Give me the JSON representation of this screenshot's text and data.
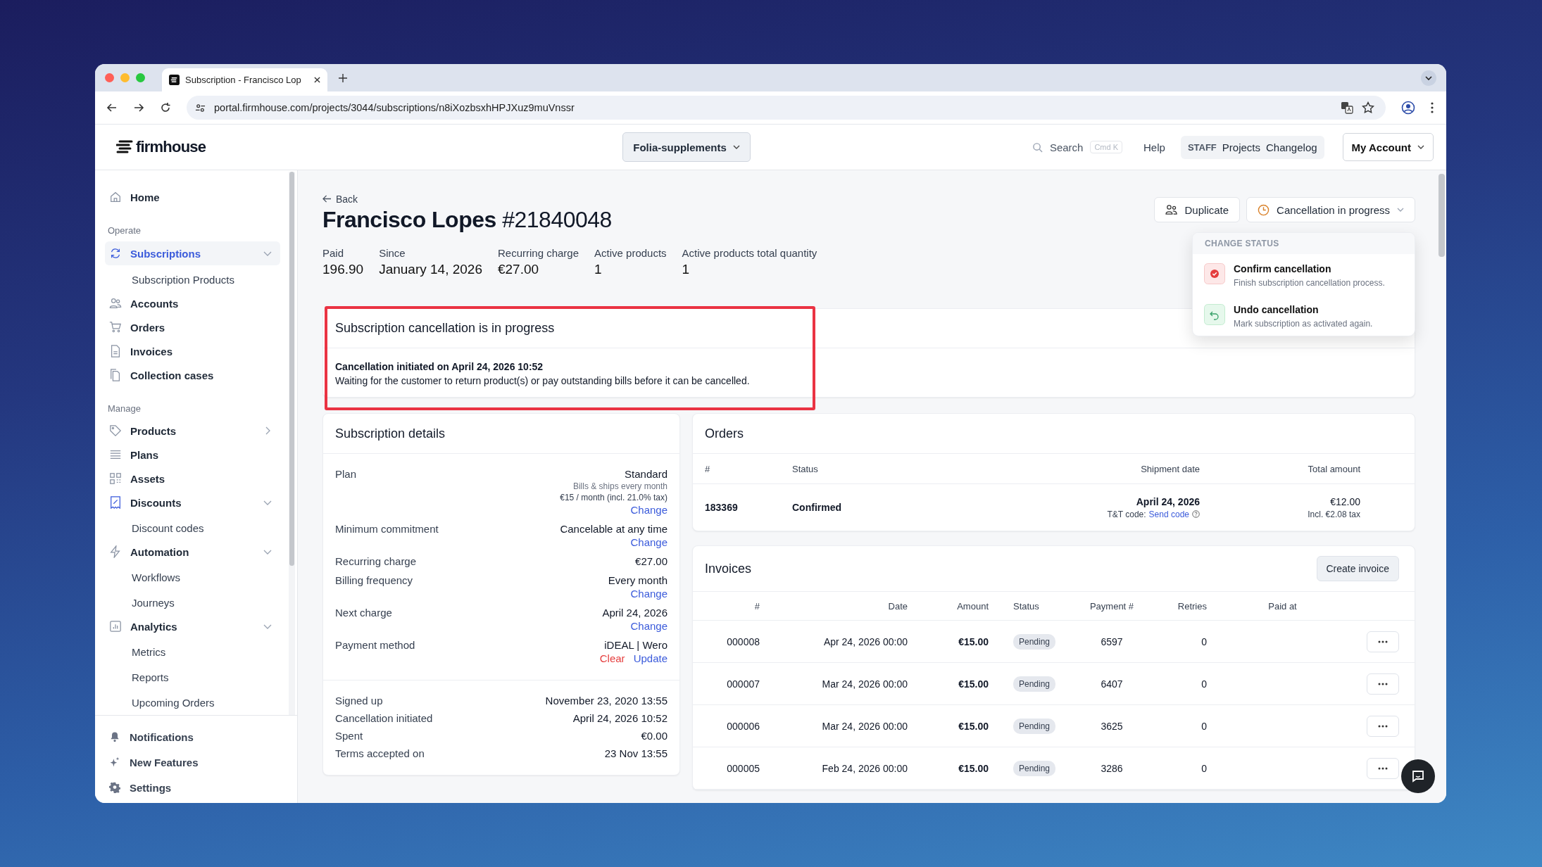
{
  "browser": {
    "tab_title": "Subscription - Francisco Lop",
    "url": "portal.firmhouse.com/projects/3044/subscriptions/n8iXozbsxhHPJXuz9muVnssr"
  },
  "header": {
    "logo": "firmhouse",
    "project": "Folia-supplements",
    "search": {
      "placeholder": "Search",
      "shortcut": "Cmd K"
    },
    "help": "Help",
    "staff_badge": "STAFF",
    "staff_links": [
      "Projects",
      "Changelog"
    ],
    "account": "My Account"
  },
  "sidebar": {
    "sections": [
      {
        "items": [
          {
            "label": "Home",
            "selected": false
          }
        ]
      },
      {
        "heading": "Operate",
        "items": [
          {
            "label": "Subscriptions",
            "selected": true,
            "expanded": true,
            "children": [
              {
                "label": "Subscription Products",
                "selected": false
              }
            ]
          },
          {
            "label": "Accounts",
            "selected": false
          },
          {
            "label": "Orders",
            "selected": false
          },
          {
            "label": "Invoices",
            "selected": false
          },
          {
            "label": "Collection cases",
            "selected": false
          }
        ]
      },
      {
        "heading": "Manage",
        "items": [
          {
            "label": "Products",
            "selected": false,
            "expanded": false
          },
          {
            "label": "Plans",
            "selected": false
          },
          {
            "label": "Assets",
            "selected": false
          },
          {
            "label": "Discounts",
            "selected": false,
            "expanded": true,
            "children": [
              {
                "label": "Discount codes",
                "selected": false
              }
            ]
          },
          {
            "label": "Automation",
            "selected": false,
            "expanded": true,
            "children": [
              {
                "label": "Workflows",
                "selected": false
              },
              {
                "label": "Journeys",
                "selected": false
              }
            ]
          },
          {
            "label": "Analytics",
            "selected": false,
            "expanded": true,
            "children": [
              {
                "label": "Metrics",
                "selected": false
              },
              {
                "label": "Reports",
                "selected": false
              },
              {
                "label": "Upcoming Orders",
                "selected": false
              }
            ]
          }
        ]
      }
    ],
    "footer": [
      "Notifications",
      "New Features",
      "Settings"
    ]
  },
  "page": {
    "back": "Back",
    "title": "**Francisco Lopes** #21840048",
    "stats": [
      {
        "label": "Paid",
        "value": "196.90"
      },
      {
        "label": "Since",
        "value": "January 14, 2026"
      },
      {
        "label": "Recurring charge",
        "value": "€27.00"
      },
      {
        "label": "Active products",
        "value": "1"
      },
      {
        "label": "Active products total quantity",
        "value": "1"
      }
    ],
    "duplicate": "Duplicate",
    "status": "Cancellation in progress",
    "status_menu": {
      "heading": "CHANGE STATUS",
      "options": [
        {
          "kind": "confirm",
          "title": "Confirm cancellation",
          "description": "Finish subscription cancellation process."
        },
        {
          "kind": "undo",
          "title": "Undo cancellation",
          "description": "Mark subscription as activated again."
        }
      ]
    }
  },
  "alert": {
    "title": "Subscription cancellation is in progress",
    "emphasis": "Cancellation initiated on April 24, 2026 10:52",
    "message": "Waiting for the customer to return product(s) or pay outstanding bills before it can be cancelled.",
    "highlighted": true
  },
  "details": {
    "title": "Subscription details",
    "groups": [
      [
        {
          "label": "Plan",
          "lines": [
            {
              "kind": "value",
              "text": "Standard"
            },
            {
              "kind": "note",
              "text": "Bills & ships every month"
            },
            {
              "kind": "price",
              "text": "€15 / month (incl. 21.0% tax)"
            }
          ],
          "actions": [
            {
              "kind": "link",
              "label": "Change"
            }
          ]
        },
        {
          "label": "Minimum commitment",
          "lines": [
            {
              "kind": "value",
              "text": "Cancelable at any time"
            }
          ],
          "actions": [
            {
              "kind": "link",
              "label": "Change"
            }
          ]
        },
        {
          "label": "Recurring charge",
          "lines": [
            {
              "kind": "value",
              "text": "€27.00"
            }
          ]
        },
        {
          "label": "Billing frequency",
          "lines": [
            {
              "kind": "value",
              "text": "Every month"
            }
          ],
          "actions": [
            {
              "kind": "link",
              "label": "Change"
            }
          ]
        },
        {
          "label": "Next charge",
          "lines": [
            {
              "kind": "value",
              "text": "April 24, 2026"
            }
          ],
          "actions": [
            {
              "kind": "link",
              "label": "Change"
            }
          ]
        },
        {
          "label": "Payment method",
          "lines": [
            {
              "kind": "value",
              "text": "iDEAL | Wero"
            }
          ],
          "actions": [
            {
              "kind": "danger",
              "label": "Clear"
            },
            {
              "kind": "link",
              "label": "Update"
            }
          ]
        }
      ],
      [
        {
          "label": "Signed up",
          "lines": [
            {
              "kind": "value",
              "text": "November 23, 2020 13:55"
            }
          ]
        },
        {
          "label": "Cancellation initiated",
          "lines": [
            {
              "kind": "value",
              "text": "April 24, 2026 10:52"
            }
          ]
        },
        {
          "label": "Spent",
          "lines": [
            {
              "kind": "value",
              "text": "€0.00"
            }
          ]
        },
        {
          "label": "Terms accepted on",
          "lines": [
            {
              "kind": "value",
              "text": "23 Nov 13:55"
            }
          ]
        }
      ]
    ]
  },
  "orders": {
    "title": "Orders",
    "columns": [
      "#",
      "Status",
      "Shipment date",
      "Total amount"
    ],
    "rows": [
      {
        "number": "183369",
        "status": "Confirmed",
        "shipment_date": "April 24, 2026",
        "tt_label": "T&T code:",
        "tt_link": "Send code",
        "total": "€12.00",
        "tax": "Incl. €2.08 tax"
      }
    ]
  },
  "invoices": {
    "title": "Invoices",
    "create": "Create invoice",
    "columns": [
      "#",
      "Date",
      "Amount",
      "Status",
      "Payment #",
      "Retries",
      "Paid at"
    ],
    "rows": [
      {
        "number": "000008",
        "date": "Apr 24, 2026 00:00",
        "amount": "€15.00",
        "status": "Pending",
        "payment": "6597",
        "retries": "0"
      },
      {
        "number": "000007",
        "date": "Mar 24, 2026 00:00",
        "amount": "€15.00",
        "status": "Pending",
        "payment": "6407",
        "retries": "0"
      },
      {
        "number": "000006",
        "date": "Mar 24, 2026 00:00",
        "amount": "€15.00",
        "status": "Pending",
        "payment": "3625",
        "retries": "0"
      },
      {
        "number": "000005",
        "date": "Feb 24, 2026 00:00",
        "amount": "€15.00",
        "status": "Pending",
        "payment": "3286",
        "retries": "0"
      }
    ]
  }
}
